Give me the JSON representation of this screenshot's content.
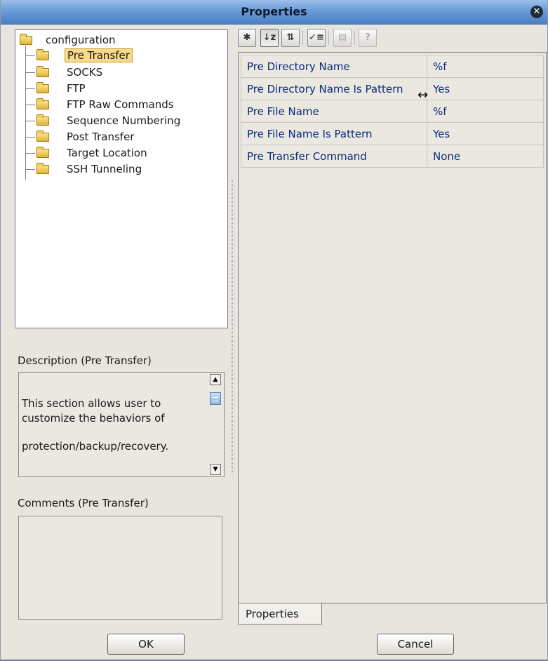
{
  "window": {
    "title": "Properties",
    "close_icon": "close-icon"
  },
  "tree": {
    "root": "configuration",
    "items": [
      {
        "label": "Pre Transfer",
        "selected": true
      },
      {
        "label": "SOCKS"
      },
      {
        "label": "FTP"
      },
      {
        "label": "FTP Raw Commands"
      },
      {
        "label": "Sequence Numbering"
      },
      {
        "label": "Post Transfer"
      },
      {
        "label": "Target Location"
      },
      {
        "label": "SSH Tunneling"
      }
    ]
  },
  "description": {
    "label": "Description (Pre Transfer)",
    "lines": [
      "This section allows user to",
      "customize the behaviors of",
      "protection/backup/recovery."
    ]
  },
  "comments": {
    "label": "Comments (Pre Transfer)",
    "value": ""
  },
  "toolbar": {
    "buttons": [
      "categorized-icon",
      "sort-az-icon",
      "sort-icon",
      "checklist-icon",
      "grid-icon",
      "help-icon"
    ]
  },
  "properties": [
    {
      "name": "Pre Directory Name",
      "value": "%f"
    },
    {
      "name": "Pre Directory Name Is Pattern",
      "value": "Yes"
    },
    {
      "name": "Pre File Name",
      "value": "%f"
    },
    {
      "name": "Pre File Name Is Pattern",
      "value": "Yes"
    },
    {
      "name": "Pre Transfer Command",
      "value": "None"
    }
  ],
  "tab": {
    "label": "Properties"
  },
  "buttons": {
    "ok": "OK",
    "cancel": "Cancel"
  }
}
